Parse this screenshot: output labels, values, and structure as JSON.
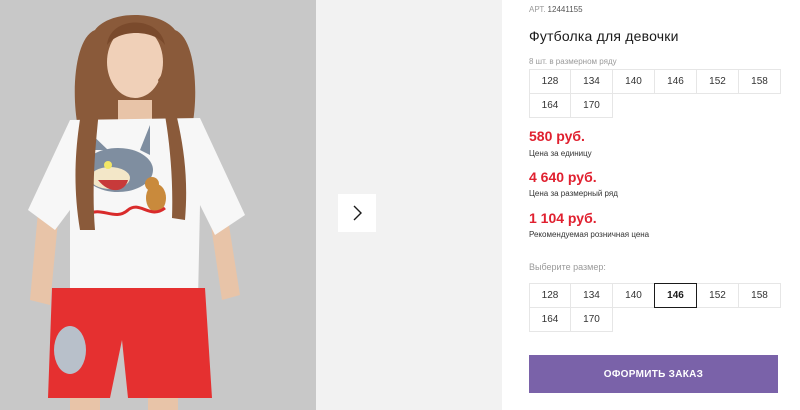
{
  "gallery": {
    "next_icon": "chevron-right-icon",
    "print_caption": "Tom and Jerry"
  },
  "product": {
    "sku_label": "АРТ.",
    "sku": "12441155",
    "title": "Футболка для девочки",
    "row_note": "8 шт. в размерном ряду",
    "row_sizes": [
      "128",
      "134",
      "140",
      "146",
      "152",
      "158",
      "164",
      "170"
    ]
  },
  "prices": {
    "unit_price": "580 руб.",
    "unit_label": "Цена за единицу",
    "row_price": "4 640 руб.",
    "row_label": "Цена за размерный ряд",
    "retail_price": "1 104 руб.",
    "retail_label": "Рекомендуемая розничная цена",
    "price_color": "#e0202f"
  },
  "size_select": {
    "label": "Выберите размер:",
    "options": [
      "128",
      "134",
      "140",
      "146",
      "152",
      "158",
      "164",
      "170"
    ],
    "selected": "146"
  },
  "order_button": {
    "label": "ОФОРМИТЬ ЗАКАЗ",
    "color": "#7a62a9"
  }
}
